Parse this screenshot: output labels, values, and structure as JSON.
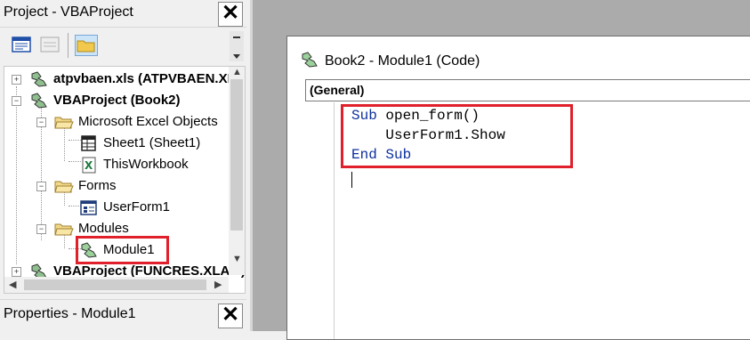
{
  "project_pane": {
    "title": "Project - VBAProject",
    "close": "✕"
  },
  "toolbar": {
    "view_code_icon": "view-code-icon",
    "view_object_icon": "view-object-icon",
    "toggle_folders_icon": "folder-icon"
  },
  "tree": {
    "items": [
      {
        "label": "atpvbaen.xls (ATPVBAEN.XLAM)",
        "bold": true
      },
      {
        "label": "VBAProject (Book2)",
        "bold": true
      },
      {
        "label": "Microsoft Excel Objects"
      },
      {
        "label": "Sheet1 (Sheet1)"
      },
      {
        "label": "ThisWorkbook"
      },
      {
        "label": "Forms"
      },
      {
        "label": "UserForm1"
      },
      {
        "label": "Modules"
      },
      {
        "label": "Module1"
      },
      {
        "label": "VBAProject (FUNCRES.XLAM)",
        "bold": true
      }
    ]
  },
  "properties_pane": {
    "title": "Properties - Module1",
    "close": "✕"
  },
  "code_window": {
    "title": "Book2 - Module1 (Code)",
    "object_dropdown": "(General)",
    "lines": [
      {
        "kw": "Sub",
        "rest": " open_form()"
      },
      {
        "kw": "",
        "rest": "    UserForm1.Show"
      },
      {
        "kw": "End Sub",
        "rest": ""
      }
    ]
  },
  "colors": {
    "highlight_border": "#e0202a",
    "keyword": "#0c2f9e",
    "mdi_background": "#ababab"
  }
}
